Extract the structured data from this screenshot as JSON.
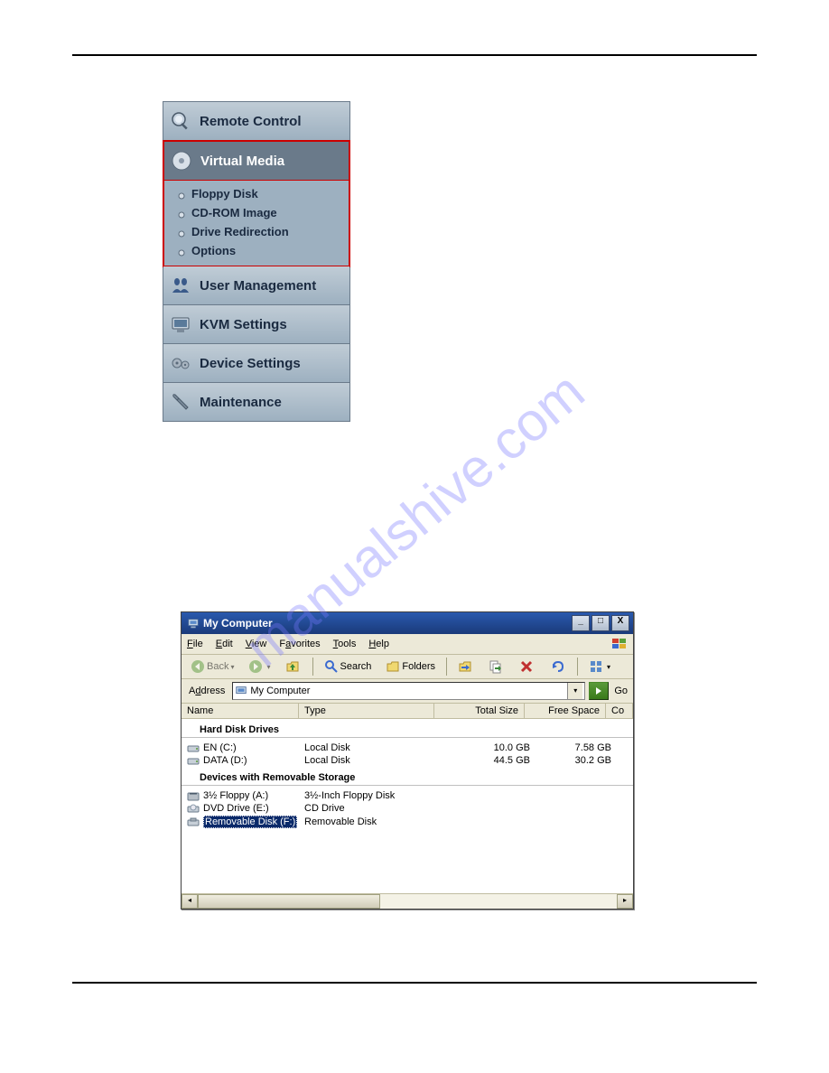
{
  "watermark": "manualshive.com",
  "sidebar": {
    "items": [
      {
        "label": "Remote Control",
        "icon": "magnifier"
      },
      {
        "label": "Virtual Media",
        "icon": "disc",
        "selected": true,
        "sub": [
          {
            "label": "Floppy Disk"
          },
          {
            "label": "CD-ROM Image"
          },
          {
            "label": "Drive Redirection"
          },
          {
            "label": "Options"
          }
        ]
      },
      {
        "label": "User Management",
        "icon": "users"
      },
      {
        "label": "KVM Settings",
        "icon": "terminal"
      },
      {
        "label": "Device Settings",
        "icon": "gears"
      },
      {
        "label": "Maintenance",
        "icon": "wrench"
      }
    ]
  },
  "mc": {
    "title": "My Computer",
    "win_buttons": {
      "min": "_",
      "max": "□",
      "close": "X"
    },
    "menu": [
      "File",
      "Edit",
      "View",
      "Favorites",
      "Tools",
      "Help"
    ],
    "toolbar": {
      "back": "Back",
      "search": "Search",
      "folders": "Folders"
    },
    "addressbar": {
      "label": "Address",
      "value": "My Computer",
      "go": "Go"
    },
    "columns": [
      "Name",
      "Type",
      "Total Size",
      "Free Space",
      "Co"
    ],
    "groups": [
      {
        "title": "Hard Disk Drives",
        "rows": [
          {
            "name": "EN (C:)",
            "type": "Local Disk",
            "size": "10.0 GB",
            "free": "7.58 GB",
            "icon": "hdd"
          },
          {
            "name": "DATA (D:)",
            "type": "Local Disk",
            "size": "44.5 GB",
            "free": "30.2 GB",
            "icon": "hdd"
          }
        ]
      },
      {
        "title": "Devices with Removable Storage",
        "rows": [
          {
            "name": "3½ Floppy (A:)",
            "type": "3½-Inch Floppy Disk",
            "size": "",
            "free": "",
            "icon": "floppy"
          },
          {
            "name": "DVD Drive (E:)",
            "type": "CD Drive",
            "size": "",
            "free": "",
            "icon": "cd"
          },
          {
            "name": "Removable Disk (F:)",
            "type": "Removable Disk",
            "size": "",
            "free": "",
            "icon": "removable",
            "selected": true
          }
        ]
      }
    ]
  }
}
